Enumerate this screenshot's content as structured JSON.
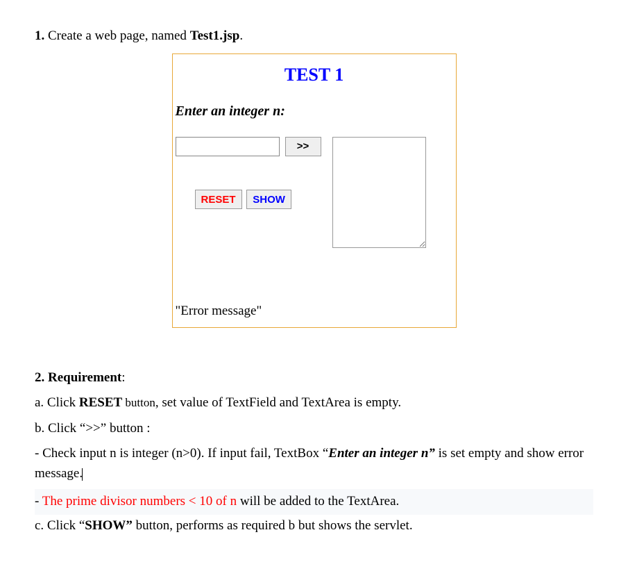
{
  "step1": {
    "number": "1.",
    "text_before": " Create a web page, named ",
    "filename": "Test1.jsp",
    "text_after": "."
  },
  "mockup": {
    "title": "TEST 1",
    "label": "Enter an integer n:",
    "go_button": ">>",
    "reset_button": "RESET",
    "show_button": "SHOW",
    "error_message": "\"Error message\""
  },
  "step2": {
    "number": "2.",
    "heading": " Requirement",
    "colon": ":"
  },
  "req_a": {
    "prefix": "a. Click ",
    "button_name": "RESET",
    "button_word": " button",
    "rest": ", set value of TextField and TextArea is empty."
  },
  "req_b": "b. Click “>>” button :",
  "req_b_check": {
    "prefix": "- Check input n is integer (n>0). If input fail, TextBox “",
    "italic": "Enter an integer n”",
    "rest": " is set empty and show error message."
  },
  "req_b_prime": {
    "prefix": "- ",
    "red_part": "The prime divisor numbers < 10 of n",
    "rest": " will be added to the TextArea."
  },
  "req_c": {
    "prefix": "c. Click “",
    "bold": "SHOW”",
    "rest": " button, performs as required b but shows the servlet."
  }
}
